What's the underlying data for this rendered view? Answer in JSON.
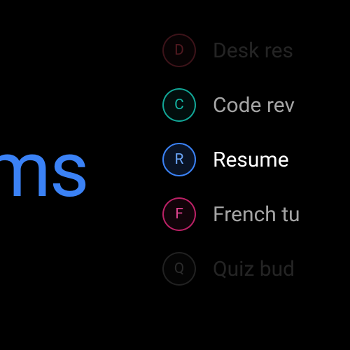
{
  "title": "ems",
  "items": [
    {
      "letter": "D",
      "label": "Desk res"
    },
    {
      "letter": "C",
      "label": "Code rev"
    },
    {
      "letter": "R",
      "label": "Resume"
    },
    {
      "letter": "F",
      "label": "French tu"
    },
    {
      "letter": "Q",
      "label": "Quiz bud"
    }
  ]
}
